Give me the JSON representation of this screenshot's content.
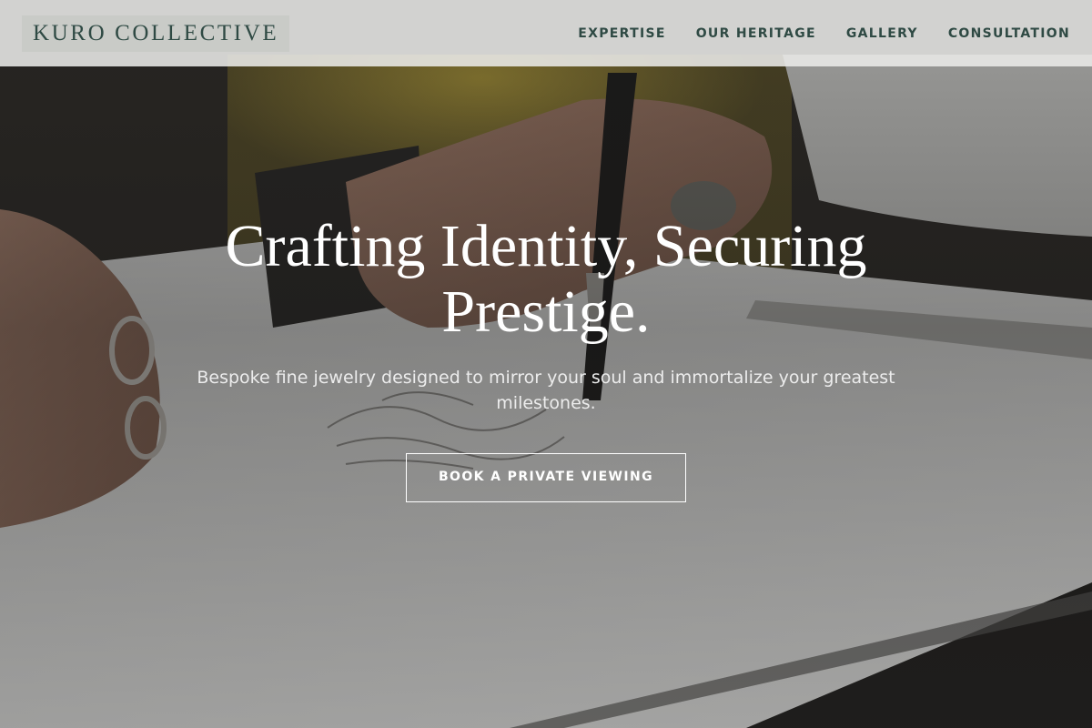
{
  "brand": {
    "logo_text": "KURO COLLECTIVE"
  },
  "nav": {
    "items": [
      {
        "label": "EXPERTISE"
      },
      {
        "label": "OUR HERITAGE"
      },
      {
        "label": "GALLERY"
      },
      {
        "label": "CONSULTATION"
      }
    ]
  },
  "hero": {
    "headline": "Crafting Identity, Securing Prestige.",
    "subheadline": "Bespoke fine jewelry designed to mirror your soul and immortalize your greatest milestones.",
    "cta_label": "BOOK A PRIVATE VIEWING",
    "background_image": "jeweler-sketching-hand"
  },
  "colors": {
    "brand_green": "#2f4a44",
    "nav_background": "#ebebe8",
    "hero_text": "#ffffff"
  }
}
